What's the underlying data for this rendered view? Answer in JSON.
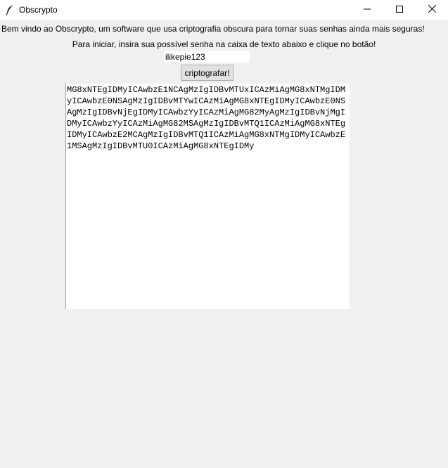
{
  "window": {
    "title": "Obscrypto",
    "icon": "feather-icon",
    "controls": [
      "minimize-icon",
      "maximize-icon",
      "close-icon"
    ]
  },
  "main": {
    "intro_text": "Bem vindo ao Obscrypto, um software que usa criptografia obscura para tornar suas senhas ainda mais seguras!",
    "instruction_text": "Para iniciar, insira sua possível senha na caixa de texto abaixo e clique no botão!",
    "password_value": "ilikepie123",
    "encrypt_button_label": "criptografar!",
    "output_text": "MG8xNTEgIDMyICAwbzE1NCAgMzIgIDBvMTUxICAzMiAgMG8xNTMgIDMyICAwbzE0NSAgMzIgIDBvMTYwICAzMiAgMG8xNTEgIDMyICAwbzE0NSAgMzIgIDBvNjEgIDMyICAwbzYyICAzMiAgMG82MyAgMzIgIDBvNjMgIDMyICAwbzYyICAzMiAgMG82MSAgMzIgIDBvMTQ1ICAzMiAgMG8xNTEgIDMyICAwbzE2MCAgMzIgIDBvMTQ1ICAzMiAgMG8xNTMgIDMyICAwbzE1MSAgMzIgIDBvMTU0ICAzMiAgMG8xNTEgIDMy"
  }
}
